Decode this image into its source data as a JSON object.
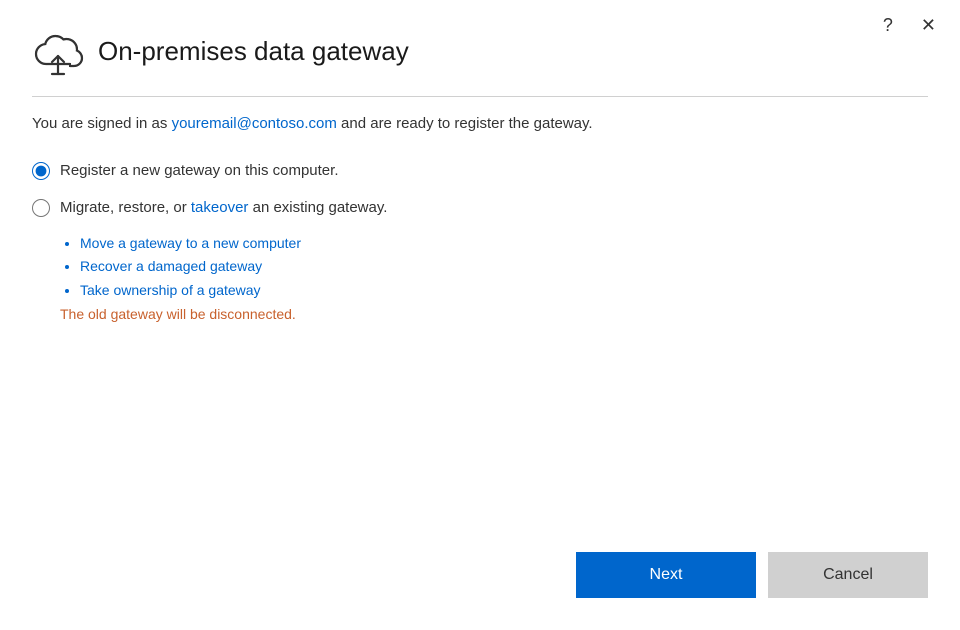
{
  "dialog": {
    "title": "On-premises data gateway",
    "help_icon": "?",
    "close_icon": "✕",
    "signed_in_prefix": "You are signed in as ",
    "signed_in_email": "youremail@contoso.com",
    "signed_in_suffix": " and are ready to register the gateway.",
    "option1": {
      "label": "Register a new gateway on this computer.",
      "checked": true
    },
    "option2": {
      "label_prefix": "Migrate, restore, or ",
      "label_link": "takeover",
      "label_suffix": " an existing gateway.",
      "checked": false,
      "sub_items": [
        "Move a gateway to a new computer",
        "Recover a damaged gateway",
        "Take ownership of a gateway"
      ],
      "note": "The old gateway will be disconnected."
    },
    "next_button": "Next",
    "cancel_button": "Cancel"
  }
}
